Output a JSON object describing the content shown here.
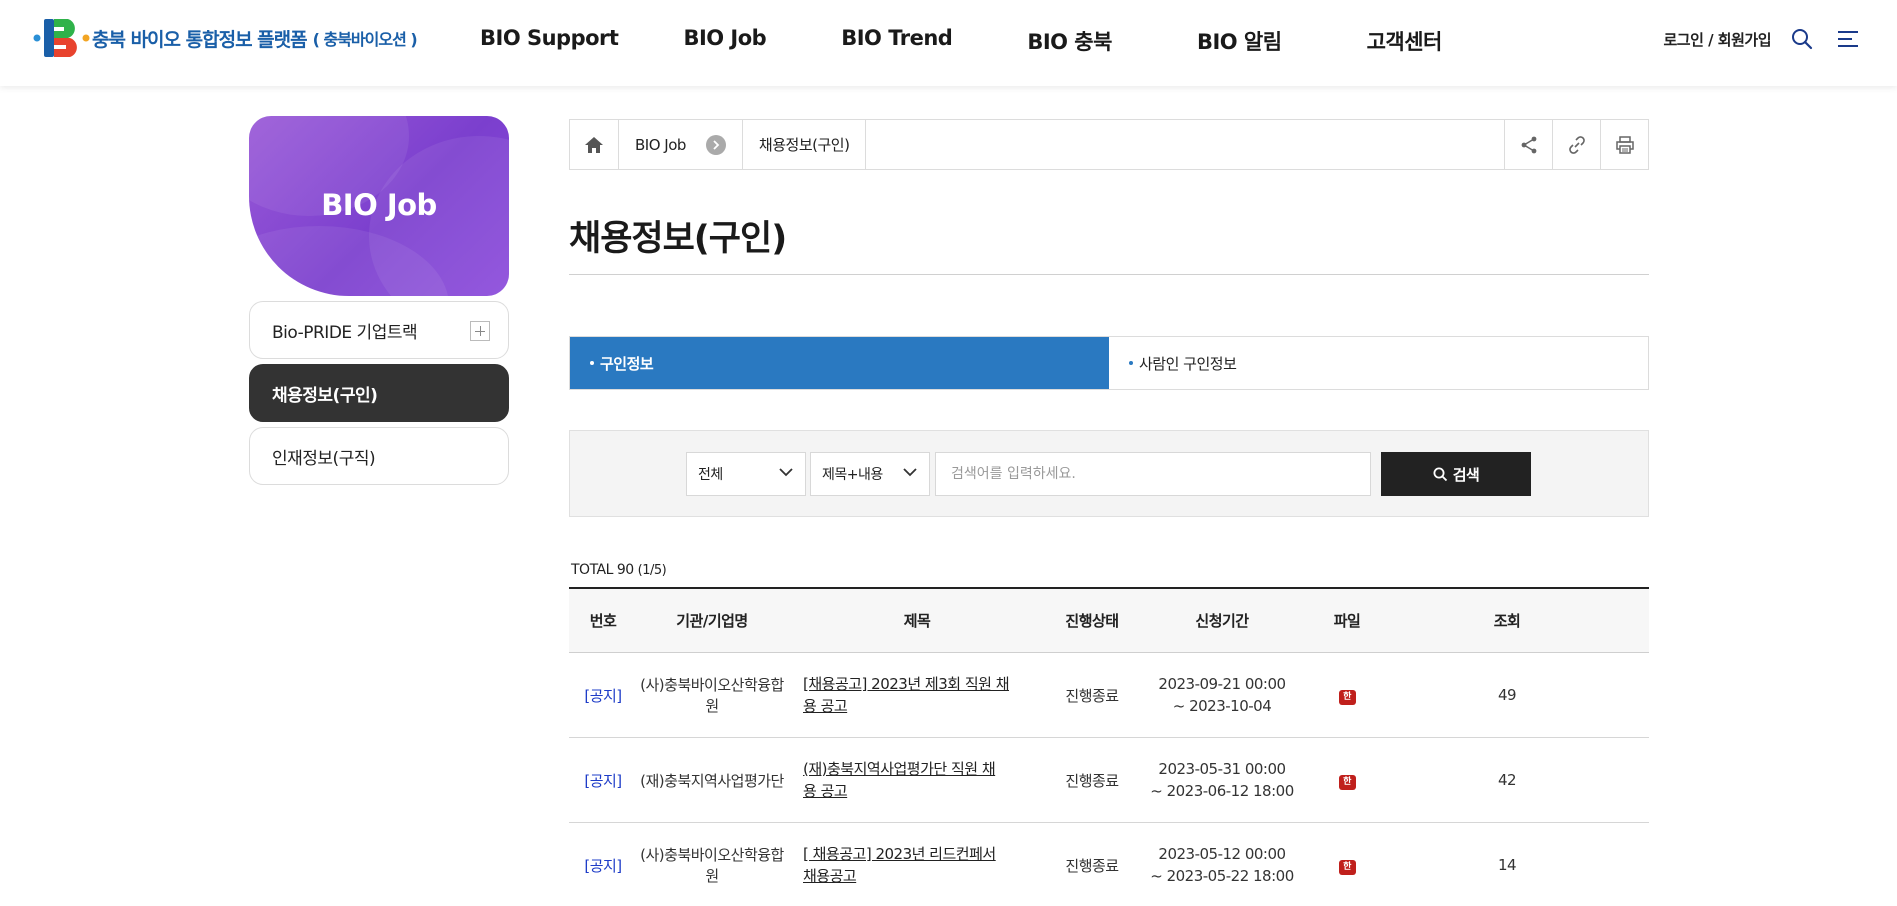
{
  "header": {
    "logo_text": "충북 바이오 통합정보 플랫폼",
    "logo_sub": "( 충북바이오션 )",
    "nav": [
      "BIO Support",
      "BIO Job",
      "BIO Trend",
      "BIO 충북",
      "BIO 알림",
      "고객센터"
    ],
    "login_label": "로그인 / 회원가입",
    "icons": [
      "search-icon",
      "menu-icon"
    ]
  },
  "sidebar": {
    "title": "BIO Job",
    "items": [
      {
        "label": "Bio-PRIDE 기업트랙",
        "expandable": true
      },
      {
        "label": "채용정보(구인)",
        "active": true
      },
      {
        "label": "인재정보(구직)"
      }
    ]
  },
  "breadcrumb": {
    "items": [
      "BIO Job",
      "채용정보(구인)"
    ],
    "tools": [
      "share-icon",
      "link-icon",
      "print-icon"
    ]
  },
  "page_title": "채용정보(구인)",
  "tabs": [
    {
      "label": "구인정보",
      "active": true
    },
    {
      "label": "사람인 구인정보"
    }
  ],
  "search": {
    "category_selected": "전체",
    "field_selected": "제목+내용",
    "placeholder": "검색어를 입력하세요.",
    "value": "",
    "button_label": "검색"
  },
  "total": {
    "label": "TOTAL 90",
    "page_info": "(1/5)"
  },
  "table": {
    "headers": [
      "번호",
      "기관/기업명",
      "제목",
      "진행상태",
      "신청기간",
      "파일",
      "조회"
    ],
    "rows": [
      {
        "no": "[공지]",
        "org": "(사)충북바이오산학융합원",
        "title_1": "[채용공고] 2023년 제3회 직원 채",
        "title_2": "용 공고",
        "status": "진행종료",
        "period_start": "2023-09-21 00:00",
        "period_end": "~ 2023-10-04",
        "file": "hwp",
        "views": "49"
      },
      {
        "no": "[공지]",
        "org": "(재)충북지역사업평가단",
        "title_1": "(재)충북지역사업평가단 직원 채",
        "title_2": "용 공고",
        "status": "진행종료",
        "period_start": "2023-05-31 00:00",
        "period_end": "~ 2023-06-12 18:00",
        "file": "hwp",
        "views": "42"
      },
      {
        "no": "[공지]",
        "org": "(사)충북바이오산학융합원",
        "title_1": "[ 채용공고] 2023년 리드컨페서",
        "title_2": "채용공고",
        "status": "진행종료",
        "period_start": "2023-05-12 00:00",
        "period_end": "~ 2023-05-22 18:00",
        "file": "hwp",
        "views": "14"
      }
    ]
  },
  "colors": {
    "brand_blue": "#1a5fa8",
    "tab_active": "#2a79c1",
    "sidebar_gradient": "#8c4cdc",
    "sidebar_active": "#333333",
    "notice": "#1e3cc8",
    "file_icon": "#c0201c"
  }
}
